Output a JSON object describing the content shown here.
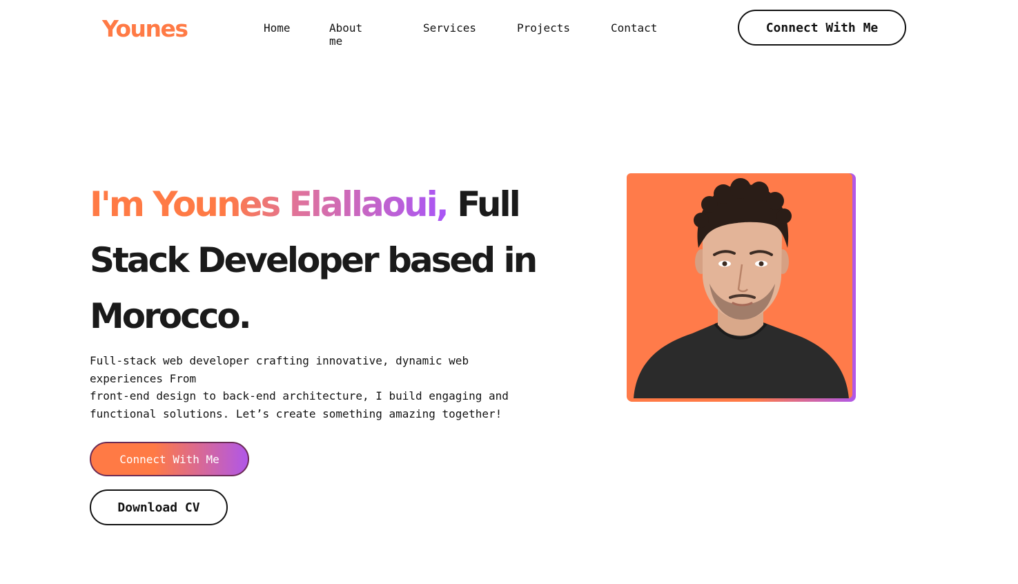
{
  "header": {
    "logo": "Younes",
    "nav": [
      "Home",
      "About me",
      "Services",
      "Projects",
      "Contact"
    ],
    "cta": "Connect With Me"
  },
  "hero": {
    "title_accent": "I'm Younes Elallaoui,",
    "title_rest_line1": " Full",
    "title_line2": "Stack Developer based in",
    "title_line3": "Morocco.",
    "description_lines": [
      "Full-stack web developer crafting innovative, dynamic web",
      "experiences From",
      "front-end design to back-end architecture, I build engaging and",
      "functional solutions. Let’s create something amazing together!"
    ],
    "primary_cta": "Connect With Me",
    "secondary_cta": "Download CV",
    "portrait_alt": "portrait-photo"
  },
  "colors": {
    "accent_orange": "#ff7a45",
    "accent_purple": "#b057e8",
    "text_dark": "#1a1a1a"
  }
}
